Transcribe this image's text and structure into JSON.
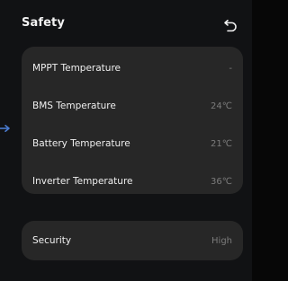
{
  "header": {
    "title": "Safety",
    "back_icon": "back-arrow-icon"
  },
  "temperatures": {
    "items": [
      {
        "label": "MPPT Temperature",
        "value": "-"
      },
      {
        "label": "BMS Temperature",
        "value": "24℃"
      },
      {
        "label": "Battery Temperature",
        "value": "21℃"
      },
      {
        "label": "Inverter Temperature",
        "value": "36℃"
      }
    ]
  },
  "security": {
    "label": "Security",
    "value": "High"
  },
  "colors": {
    "background": "#111214",
    "card": "#272727",
    "label": "#efefef",
    "value": "#7c7c7c",
    "arrow": "#4a7bd0"
  },
  "icons": {
    "side_arrow": "arrow-right-icon"
  }
}
